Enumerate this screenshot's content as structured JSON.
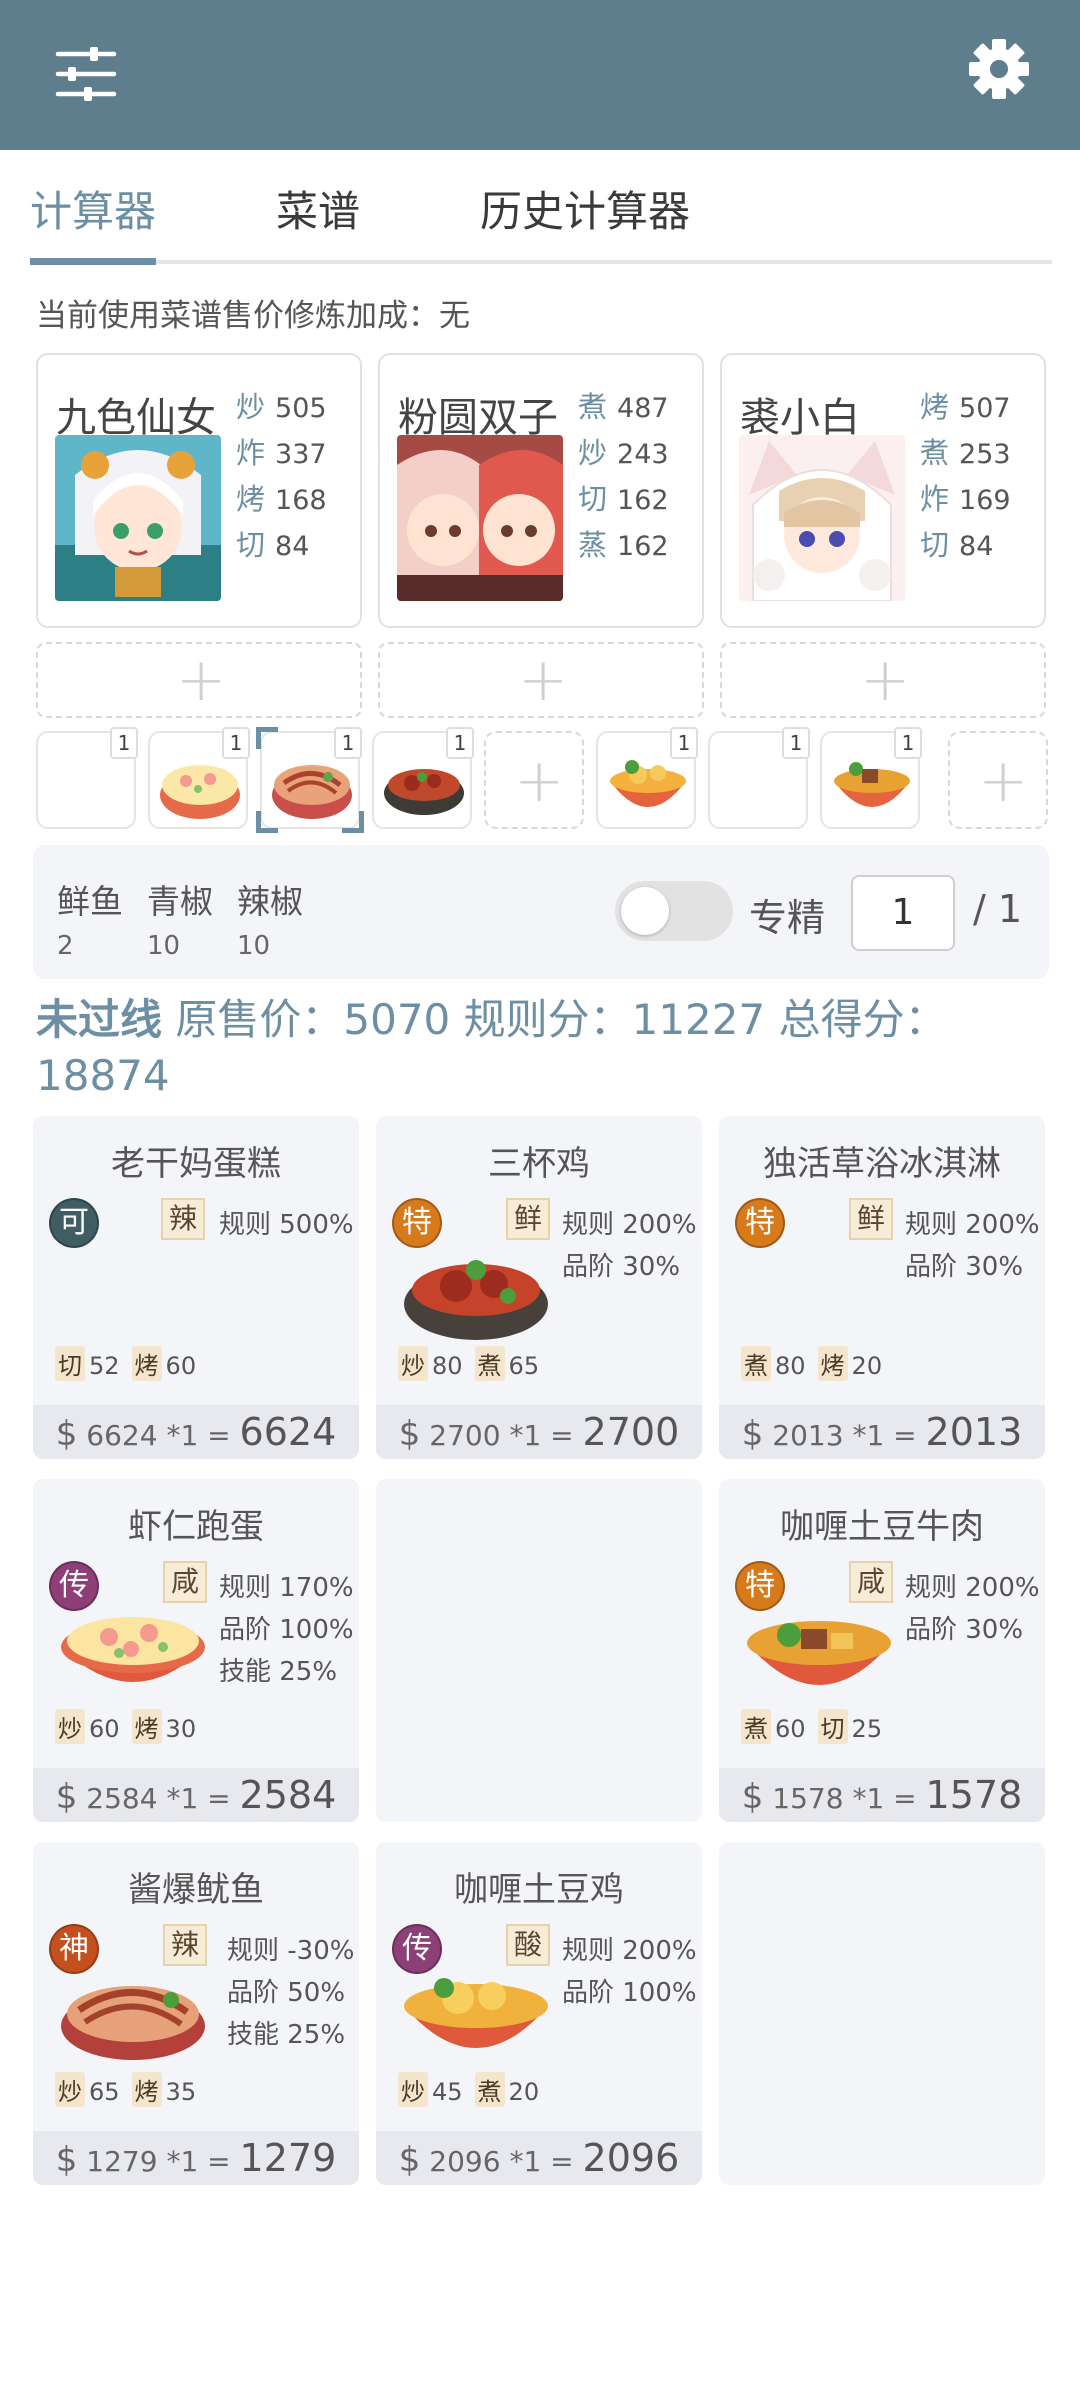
{
  "tabs": [
    "计算器",
    "菜谱",
    "历史计算器"
  ],
  "bonus_line": "当前使用菜谱售价修炼加成：无",
  "chefs": [
    {
      "name": "九色仙女",
      "stats": [
        [
          "炒",
          "505"
        ],
        [
          "炸",
          "337"
        ],
        [
          "烤",
          "168"
        ],
        [
          "切",
          "84"
        ]
      ]
    },
    {
      "name": "粉圆双子",
      "stats": [
        [
          "煮",
          "487"
        ],
        [
          "炒",
          "243"
        ],
        [
          "切",
          "162"
        ],
        [
          "蒸",
          "162"
        ]
      ]
    },
    {
      "name": "裘小白",
      "stats": [
        [
          "烤",
          "507"
        ],
        [
          "煮",
          "253"
        ],
        [
          "炸",
          "169"
        ],
        [
          "切",
          "84"
        ]
      ]
    }
  ],
  "recipe_slots": [
    "1",
    "1",
    "1",
    "1",
    "1",
    "1",
    "1"
  ],
  "ingredients": [
    {
      "name": "鲜鱼",
      "count": "2"
    },
    {
      "name": "青椒",
      "count": "10"
    },
    {
      "name": "辣椒",
      "count": "10"
    }
  ],
  "specialize": {
    "label": "专精",
    "value": "1",
    "total": "/ 1"
  },
  "score": {
    "status": "未过线",
    "text": "原售价：5070 规则分：11227 总得分：18874"
  },
  "dishes": [
    {
      "title": "老干妈蛋糕",
      "rarity": "可",
      "flavor": "辣",
      "rules": [
        "规则 500%"
      ],
      "skills": [
        [
          "切",
          "52"
        ],
        [
          "烤",
          "60"
        ]
      ],
      "price": "6624 *1",
      "total": "6624"
    },
    {
      "title": "三杯鸡",
      "rarity": "特",
      "flavor": "鲜",
      "rules": [
        "规则 200%",
        "品阶 30%"
      ],
      "skills": [
        [
          "炒",
          "80"
        ],
        [
          "煮",
          "65"
        ]
      ],
      "price": "2700 *1",
      "total": "2700"
    },
    {
      "title": "独活草浴冰淇淋",
      "rarity": "特",
      "flavor": "鲜",
      "rules": [
        "规则 200%",
        "品阶 30%"
      ],
      "skills": [
        [
          "煮",
          "80"
        ],
        [
          "烤",
          "20"
        ]
      ],
      "price": "2013 *1",
      "total": "2013"
    },
    {
      "title": "虾仁跑蛋",
      "rarity": "传",
      "flavor": "咸",
      "rules": [
        "规则 170%",
        "品阶 100%",
        "技能 25%"
      ],
      "skills": [
        [
          "炒",
          "60"
        ],
        [
          "烤",
          "30"
        ]
      ],
      "price": "2584 *1",
      "total": "2584"
    },
    {
      "title": "咖喱土豆牛肉",
      "rarity": "特",
      "flavor": "咸",
      "rules": [
        "规则 200%",
        "品阶 30%"
      ],
      "skills": [
        [
          "煮",
          "60"
        ],
        [
          "切",
          "25"
        ]
      ],
      "price": "1578 *1",
      "total": "1578"
    },
    {
      "title": "酱爆鱿鱼",
      "rarity": "神",
      "flavor": "辣",
      "rules": [
        "规则 -30%",
        "品阶 50%",
        "技能 25%"
      ],
      "skills": [
        [
          "炒",
          "65"
        ],
        [
          "烤",
          "35"
        ]
      ],
      "price": "1279 *1",
      "total": "1279"
    },
    {
      "title": "咖喱土豆鸡",
      "rarity": "传",
      "flavor": "酸",
      "rules": [
        "规则 200%",
        "品阶 100%"
      ],
      "skills": [
        [
          "炒",
          "45"
        ],
        [
          "煮",
          "20"
        ]
      ],
      "price": "2096 *1",
      "total": "2096"
    }
  ],
  "currency_symbol": "$",
  "equals": "=",
  "colors": {
    "header": "#5e7d8d",
    "accent": "#6c8fa3",
    "rarity_ke": "#3f5d63",
    "rarity_te": "#d77a1c",
    "rarity_chuan": "#8e3f78",
    "rarity_shen": "#c4501e"
  },
  "icons": {
    "menu": "sliders-icon",
    "settings": "gear-icon",
    "add": "plus-icon"
  }
}
